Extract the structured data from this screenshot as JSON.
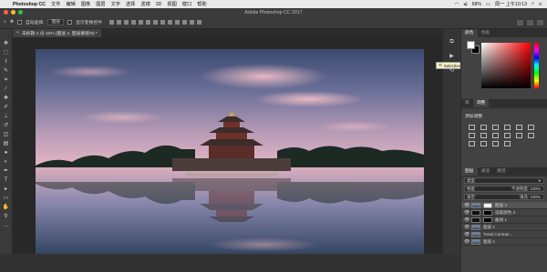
{
  "menubar": {
    "apple_symbol": "",
    "app_name": "Photoshop CC",
    "items": [
      "文件",
      "编辑",
      "图像",
      "图层",
      "文字",
      "选择",
      "滤镜",
      "3D",
      "视图",
      "窗口",
      "帮助"
    ],
    "battery": "68%",
    "clock": "周一 上午10:13"
  },
  "window": {
    "title": "Adobe Photoshop CC 2017"
  },
  "options_bar": {
    "auto_select_label": "自动选择:",
    "auto_select_value": "图层",
    "show_transform_label": "显示变换控件"
  },
  "document_tab": {
    "title": "未标题-1 @ 10% (图层 2, 图层蒙版/8) *",
    "close_symbol": "×"
  },
  "tooltip": {
    "label": "Selective Tool"
  },
  "color_panel": {
    "tabs": [
      "颜色",
      "色板"
    ]
  },
  "adjustments_panel": {
    "tabs": [
      "库",
      "调整"
    ],
    "add_label": "添加调整"
  },
  "layers_panel": {
    "tabs": [
      "图层",
      "通道",
      "路径"
    ],
    "filter_kind": "类型",
    "blend_mode": "明度",
    "opacity_label": "不透明度:",
    "opacity_value": "100%",
    "lock_label": "锁定:",
    "fill_label": "填充:",
    "fill_value": "100%",
    "layers": [
      {
        "name": "图层 2"
      },
      {
        "name": "选取颜色 2"
      },
      {
        "name": "曲线 1"
      },
      {
        "name": "图层 1"
      },
      {
        "name": "Tonal Contras..."
      },
      {
        "name": "图层 1"
      }
    ]
  },
  "colors": {
    "accent": "#1a73e8",
    "panel_bg": "#424242",
    "app_bg": "#323232",
    "sky_top": "#44557a",
    "sky_glow": "#e7a3b6",
    "water": "#3a4d6a"
  }
}
